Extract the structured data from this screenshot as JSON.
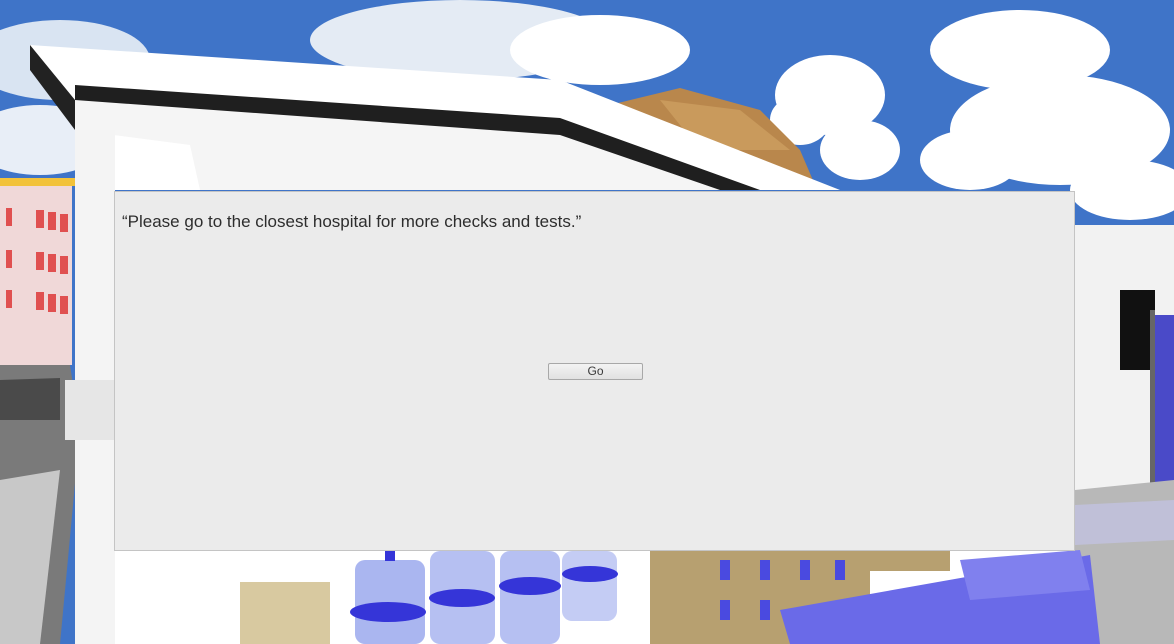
{
  "dialog": {
    "message": "“Please go to the closest hospital for more checks and tests.”",
    "go_label": "Go"
  },
  "scene": {
    "description_colors": {
      "sky": "#3d72c6",
      "cloud": "#ffffff",
      "roof": "#f4f4f4",
      "wood": "#c8a05a",
      "bottle_blue": "#3a3ae0",
      "panel": "#ebebeb"
    }
  }
}
